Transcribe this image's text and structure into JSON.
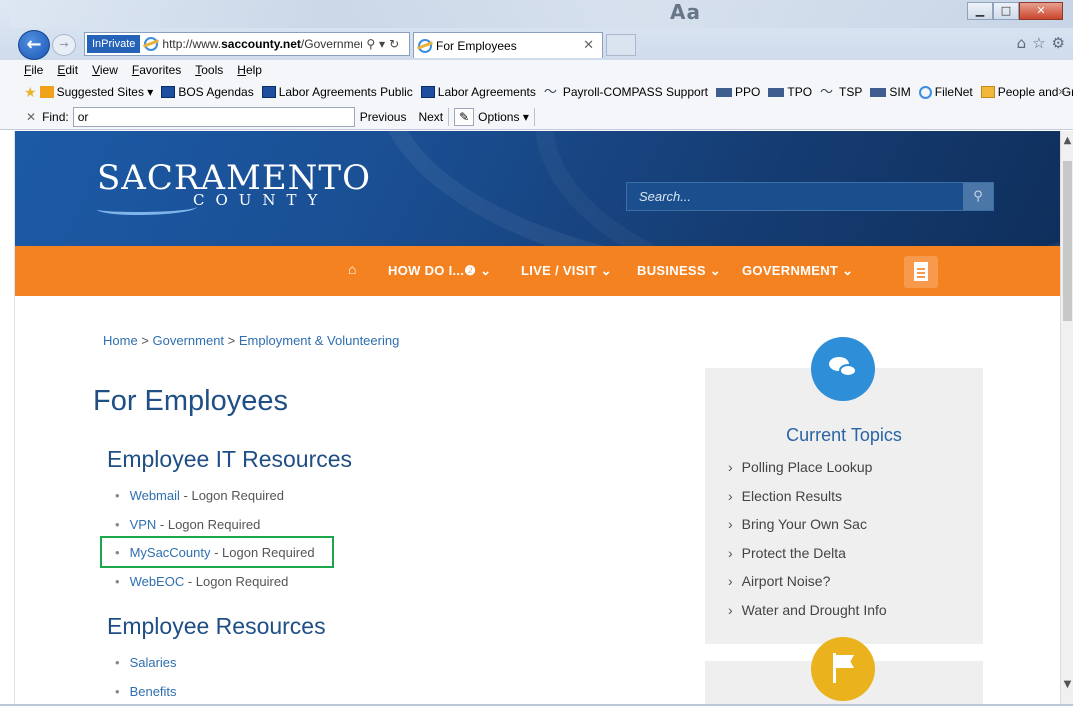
{
  "browser": {
    "inprivate_label": "InPrivate",
    "url_prefix": "http://www.",
    "url_domain": "saccounty.net",
    "url_rest": "/Governmen",
    "tab_title": "For Employees",
    "win_title_ghost": "Aa",
    "menu": [
      "File",
      "Edit",
      "View",
      "Favorites",
      "Tools",
      "Help"
    ],
    "favorites": [
      {
        "label": "Suggested Sites ▾",
        "icon": "bing-icon",
        "kind": "bing"
      },
      {
        "label": "BOS Agendas",
        "icon": "sac-icon",
        "kind": "sac"
      },
      {
        "label": "Labor Agreements Public",
        "icon": "sac-icon",
        "kind": "sac"
      },
      {
        "label": "Labor Agreements",
        "icon": "sac-icon",
        "kind": "sac"
      },
      {
        "label": "Payroll-COMPASS Support",
        "icon": "wave-icon",
        "kind": "wave"
      },
      {
        "label": "PPO",
        "icon": "flag-icon",
        "kind": "flag"
      },
      {
        "label": "TPO",
        "icon": "flag-icon",
        "kind": "flag"
      },
      {
        "label": "TSP",
        "icon": "wave-icon",
        "kind": "wave"
      },
      {
        "label": "SIM",
        "icon": "flag-icon",
        "kind": "flag"
      },
      {
        "label": "FileNet",
        "icon": "ie-icon",
        "kind": "ie"
      },
      {
        "label": "People and Groups",
        "icon": "folder-icon",
        "kind": "folder"
      }
    ],
    "find": {
      "label": "Find:",
      "value": "or",
      "previous": "Previous",
      "next": "Next",
      "options": "Options ▾"
    }
  },
  "site": {
    "logo_main": "SACRAMENTO",
    "logo_sub": "COUNTY",
    "search_placeholder": "Search...",
    "nav": {
      "how_do_i": "HOW DO I...❷ ⌄",
      "live_visit": "LIVE / VISIT ⌄",
      "business": "BUSINESS ⌄",
      "government": "GOVERNMENT ⌄"
    },
    "colors": {
      "header_blue": "#1a4f93",
      "nav_orange": "#f58220",
      "link_blue": "#2f6fb0",
      "highlight_green": "#1aa84a"
    }
  },
  "breadcrumb": {
    "home": "Home",
    "sep": " > ",
    "government": "Government",
    "employment": "Employment & Volunteering"
  },
  "page_title": "For Employees",
  "it_resources": {
    "title": "Employee IT Resources",
    "items": [
      {
        "link": "Webmail",
        "note": " - Logon Required"
      },
      {
        "link": "VPN",
        "note": " - Logon Required"
      },
      {
        "link": "MySacCounty",
        "note": " - Logon Required"
      },
      {
        "link": "WebEOC",
        "note": " - Logon Required"
      }
    ]
  },
  "employee_resources": {
    "title": "Employee Resources",
    "items": [
      "Salaries",
      "Benefits"
    ]
  },
  "current_topics": {
    "title": "Current Topics",
    "items": [
      "Polling Place Lookup",
      "Election Results",
      "Bring Your Own Sac",
      "Protect the Delta",
      "Airport Noise?",
      "Water and Drought Info"
    ]
  }
}
